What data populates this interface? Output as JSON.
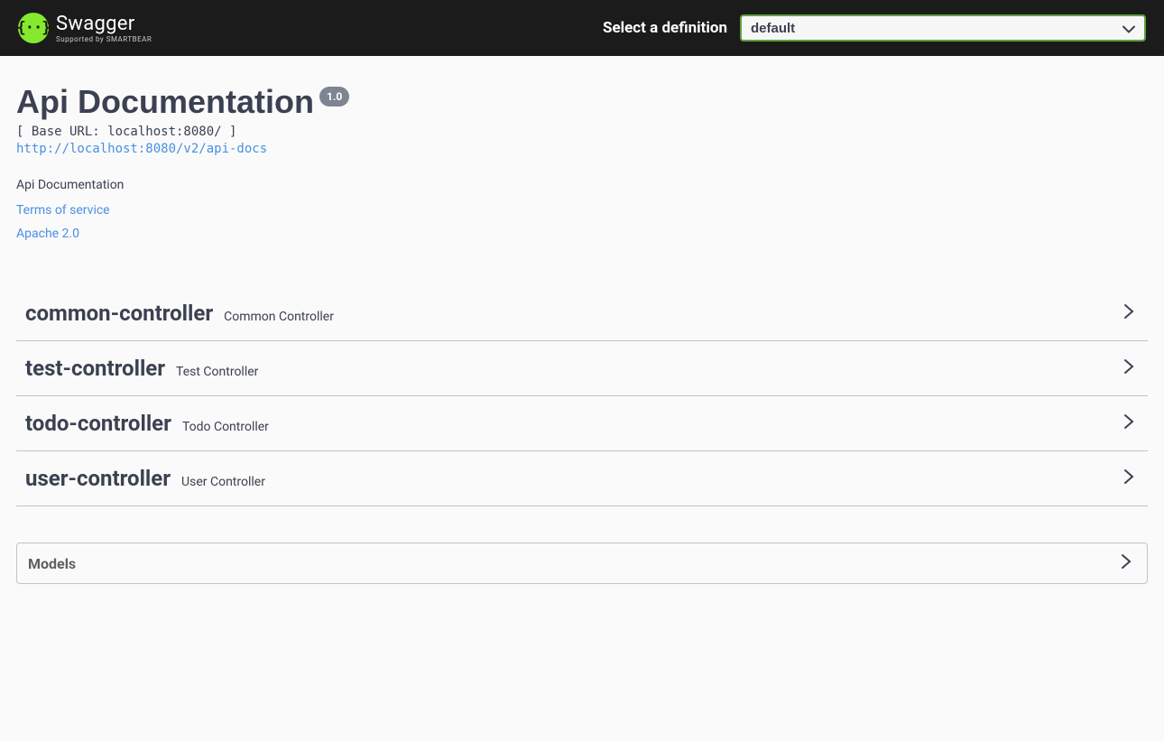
{
  "topbar": {
    "logo_main": "Swagger",
    "logo_sub": "Supported by SMARTBEAR",
    "definition_label": "Select a definition",
    "definition_value": "default"
  },
  "info": {
    "title": "Api Documentation",
    "version": "1.0",
    "base_url": "[ Base URL: localhost:8080/ ]",
    "docs_url": "http://localhost:8080/v2/api-docs",
    "description": "Api Documentation",
    "terms_link": "Terms of service",
    "license_link": "Apache 2.0"
  },
  "tags": [
    {
      "name": "common-controller",
      "desc": "Common Controller"
    },
    {
      "name": "test-controller",
      "desc": "Test Controller"
    },
    {
      "name": "todo-controller",
      "desc": "Todo Controller"
    },
    {
      "name": "user-controller",
      "desc": "User Controller"
    }
  ],
  "models": {
    "title": "Models"
  }
}
